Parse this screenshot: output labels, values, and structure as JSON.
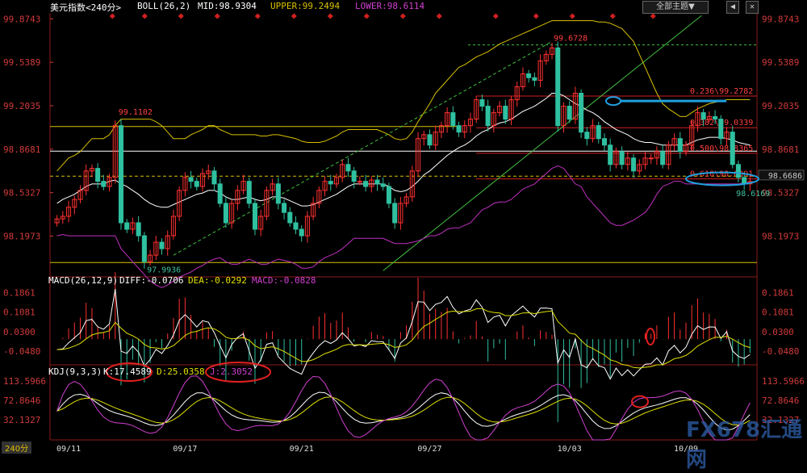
{
  "header": {
    "title": "美元指数<240分>",
    "boll_label": "BOLL(26,2)",
    "mid": "MID:98.9304",
    "upper": "UPPER:99.2494",
    "lower": "LOWER:98.6114",
    "theme_button": "全部主题▼",
    "win_buttons": [
      "◀",
      "✕"
    ]
  },
  "timeframe": "240分",
  "watermark": "FX678汇通网",
  "colors": {
    "up": "#ff3030",
    "down": "#2fc0a0",
    "mid": "#ffffff",
    "upper": "#d8c000",
    "lower": "#c030c0",
    "axis": "#d23a3a"
  },
  "chart_data": [
    {
      "type": "candlestick",
      "name": "price",
      "yaxis_ticks": [
        "99.8743",
        "99.5389",
        "99.2035",
        "98.8681",
        "98.5327",
        "98.1973"
      ],
      "ylim": [
        97.92,
        99.92
      ],
      "x_labels": [
        "09/11",
        "09/17",
        "09/21",
        "09/27",
        "10/03",
        "10/09"
      ],
      "annotations": {
        "high1": "99.1102",
        "low1": "97.9936",
        "high2": "99.6728",
        "low2": "98.6169",
        "current": "98.6686"
      },
      "fib_levels": [
        {
          "label": "0.236\\99.2782",
          "value": 99.2782
        },
        {
          "label": "0.382\\99.0339",
          "value": 99.0339
        },
        {
          "label": "0.500\\98.8365",
          "value": 98.8365
        },
        {
          "label": "0.618\\98.6391",
          "value": 98.6391
        }
      ],
      "hlines": [
        99.043,
        98.853,
        97.993,
        99.673
      ],
      "trend_support": [
        [
          98.1,
          0
        ],
        [
          99.85,
          1
        ]
      ],
      "trend_channel": [
        [
          98.0,
          0
        ],
        [
          99.68,
          1
        ]
      ],
      "close": [
        98.33,
        98.35,
        98.42,
        98.48,
        98.55,
        98.7,
        98.72,
        98.62,
        98.58,
        98.65,
        99.05,
        98.3,
        98.25,
        98.3,
        98.2,
        98.0,
        98.05,
        98.15,
        98.1,
        98.2,
        98.35,
        98.55,
        98.65,
        98.62,
        98.58,
        98.68,
        98.7,
        98.6,
        98.45,
        98.3,
        98.45,
        98.55,
        98.62,
        98.45,
        98.25,
        98.35,
        98.55,
        98.6,
        98.45,
        98.38,
        98.3,
        98.25,
        98.2,
        98.35,
        98.45,
        98.55,
        98.62,
        98.6,
        98.65,
        98.75,
        98.7,
        98.62,
        98.62,
        98.58,
        98.63,
        98.6,
        98.58,
        98.45,
        98.3,
        98.45,
        98.5,
        98.7,
        98.95,
        98.98,
        98.9,
        99.0,
        99.05,
        99.15,
        99.05,
        99.0,
        99.05,
        99.1,
        99.25,
        99.2,
        99.05,
        99.15,
        99.2,
        99.1,
        99.25,
        99.35,
        99.45,
        99.42,
        99.4,
        99.55,
        99.6,
        99.65,
        99.05,
        99.2,
        99.1,
        99.3,
        99.0,
        98.95,
        99.05,
        98.95,
        98.9,
        98.75,
        98.85,
        98.75,
        98.8,
        98.7,
        98.75,
        98.8,
        98.8,
        98.85,
        98.75,
        98.9,
        98.95,
        98.85,
        98.9,
        99.05,
        99.15,
        99.1,
        99.12,
        99.1,
        98.95,
        99.0,
        98.75,
        98.65,
        98.6,
        98.62
      ],
      "boll_mid": [
        98.45,
        98.48,
        98.5,
        98.52,
        98.55,
        98.58,
        98.6,
        98.6,
        98.6,
        98.62,
        98.63,
        98.6,
        98.58,
        98.55,
        98.52,
        98.48,
        98.45,
        98.43,
        98.42,
        98.42,
        98.44,
        98.46,
        98.48,
        98.5,
        98.52,
        98.53,
        98.55,
        98.55,
        98.53,
        98.5,
        98.48,
        98.48,
        98.49,
        98.5,
        98.48,
        98.47,
        98.48,
        98.5,
        98.5,
        98.49,
        98.47,
        98.45,
        98.43,
        98.43,
        98.44,
        98.46,
        98.48,
        98.5,
        98.52,
        98.55,
        98.58,
        98.6,
        98.6,
        98.6,
        98.6,
        98.6,
        98.6,
        98.58,
        98.55,
        98.54,
        98.55,
        98.58,
        98.62,
        98.67,
        98.7,
        98.74,
        98.78,
        98.82,
        98.85,
        98.88,
        98.9,
        98.93,
        98.97,
        99,
        99.02,
        99.05,
        99.07,
        99.08,
        99.1,
        99.13,
        99.16,
        99.18,
        99.2,
        99.23,
        99.26,
        99.3,
        99.3,
        99.28,
        99.25,
        99.22,
        99.2,
        99.17,
        99.15,
        99.12,
        99.08,
        99.05,
        99.02,
        99,
        98.98,
        98.95,
        98.93,
        98.92,
        98.92,
        98.91,
        98.9,
        98.9,
        98.9,
        98.9,
        98.9,
        98.92,
        98.94,
        98.95,
        98.96,
        98.96,
        98.96,
        98.95,
        98.94,
        98.92,
        98.91,
        98.9
      ],
      "boll_upper": [
        98.7,
        98.75,
        98.8,
        98.82,
        98.85,
        98.9,
        98.95,
        98.95,
        98.95,
        98.98,
        99.05,
        99.1,
        99.1,
        99.1,
        99.1,
        99.1,
        99.1,
        99.08,
        99.05,
        99.0,
        98.95,
        98.95,
        98.95,
        98.98,
        99.0,
        99.02,
        99.05,
        99.05,
        99.02,
        99,
        98.98,
        98.98,
        98.98,
        98.98,
        98.98,
        98.97,
        98.97,
        98.98,
        98.98,
        98.97,
        98.96,
        98.95,
        98.93,
        98.92,
        98.92,
        98.92,
        98.93,
        98.95,
        98.97,
        99,
        99.02,
        99.02,
        99.02,
        99.02,
        99.02,
        99.02,
        99.0,
        98.98,
        98.95,
        98.94,
        98.95,
        99.0,
        99.08,
        99.15,
        99.22,
        99.3,
        99.35,
        99.4,
        99.45,
        99.5,
        99.52,
        99.55,
        99.58,
        99.6,
        99.62,
        99.65,
        99.68,
        99.7,
        99.72,
        99.74,
        99.76,
        99.78,
        99.8,
        99.82,
        99.84,
        99.86,
        99.86,
        99.86,
        99.86,
        99.86,
        99.86,
        99.86,
        99.86,
        99.85,
        99.85,
        99.84,
        99.82,
        99.8,
        99.75,
        99.7,
        99.6,
        99.5,
        99.4,
        99.3,
        99.22,
        99.18,
        99.15,
        99.12,
        99.12,
        99.15,
        99.18,
        99.2,
        99.22,
        99.23,
        99.24,
        99.25,
        99.25,
        99.25,
        99.25,
        99.25
      ],
      "boll_lower": [
        98.2,
        98.21,
        98.2,
        98.2,
        98.2,
        98.2,
        98.2,
        98.2,
        98.2,
        98.2,
        98.2,
        98.1,
        98.05,
        98.0,
        97.95,
        97.9,
        97.85,
        97.82,
        97.8,
        97.82,
        97.85,
        97.88,
        97.9,
        97.92,
        97.95,
        97.97,
        98.0,
        98.02,
        98.03,
        98.0,
        97.98,
        97.98,
        98.0,
        98.02,
        98.0,
        97.98,
        97.98,
        98.0,
        98.02,
        98.01,
        98.0,
        97.98,
        97.95,
        97.95,
        97.96,
        98.0,
        98.03,
        98.05,
        98.07,
        98.1,
        98.14,
        98.18,
        98.18,
        98.18,
        98.18,
        98.18,
        98.18,
        98.16,
        98.14,
        98.14,
        98.14,
        98.15,
        98.16,
        98.18,
        98.2,
        98.2,
        98.22,
        98.25,
        98.26,
        98.26,
        98.28,
        98.3,
        98.35,
        98.4,
        98.42,
        98.45,
        98.46,
        98.46,
        98.48,
        98.52,
        98.56,
        98.58,
        98.6,
        98.64,
        98.68,
        98.72,
        98.74,
        98.72,
        98.66,
        98.6,
        98.58,
        98.5,
        98.45,
        98.4,
        98.35,
        98.3,
        98.28,
        98.28,
        98.3,
        98.32,
        98.35,
        98.38,
        98.44,
        98.52,
        98.58,
        98.6,
        98.62,
        98.62,
        98.6,
        98.6,
        98.6,
        98.6,
        98.6,
        98.6,
        98.6,
        98.6,
        98.6,
        98.6,
        98.61,
        98.61
      ]
    },
    {
      "type": "macd",
      "label": "MACD(26,12,9)",
      "diff_label": "DIFF:-0.0706",
      "dea_label": "DEA:-0.0292",
      "macd_label": "MACD:-0.0828",
      "yaxis_ticks": [
        "0.1861",
        "0.1081",
        "0.0300",
        "-0.0480"
      ],
      "ylim": [
        -0.09,
        0.22
      ]
    },
    {
      "type": "kdj",
      "label": "KDJ(9,3,3)",
      "k_label": "K:17.4589",
      "d_label": "D:25.0358",
      "j_label": "J:2.3052",
      "yaxis_ticks": [
        "113.5966",
        "72.8646",
        "32.1327"
      ],
      "ylim": [
        -10,
        125
      ]
    }
  ]
}
